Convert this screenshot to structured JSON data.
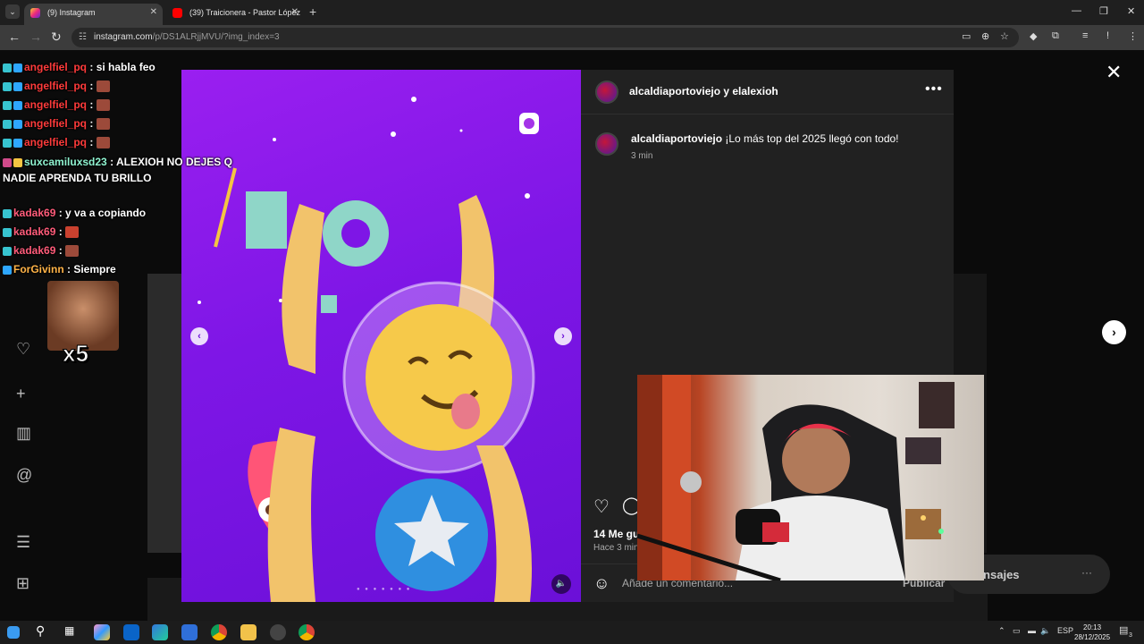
{
  "browser": {
    "tabs": [
      {
        "title": "(9) Instagram",
        "active": true
      },
      {
        "title": "(39) Traicionera - Pastor López",
        "active": false
      }
    ],
    "url_host": "instagram.com",
    "url_path": "/p/DS1ALRjjMVU/?img_index=3"
  },
  "post": {
    "author_header": "alcaldiaportoviejo y elalexioh",
    "caption_user": "alcaldiaportoviejo",
    "caption_text": "¡Lo más top del 2025 llegó con todo!",
    "caption_time": "3 min",
    "likes": "14 Me gusta",
    "time_ago": "Hace 3 minutos",
    "comment_placeholder": "Añade un comentario...",
    "publish_label": "Publicar"
  },
  "messages": {
    "label": "Mensajes",
    "badge": "9+"
  },
  "chat": [
    {
      "user": "angelfiel_pq",
      "text": ": si habla feo",
      "color": "red",
      "emote": false
    },
    {
      "user": "angelfiel_pq",
      "text": ":",
      "color": "red",
      "emote": true
    },
    {
      "user": "angelfiel_pq",
      "text": ":",
      "color": "red",
      "emote": true
    },
    {
      "user": "angelfiel_pq",
      "text": ":",
      "color": "red",
      "emote": true
    },
    {
      "user": "angelfiel_pq",
      "text": ":",
      "color": "red",
      "emote": true
    },
    {
      "user": "suxcamiluxsd23",
      "text": ": ALEXIOH NO DEJES Q",
      "color": "cyan",
      "emote": false
    },
    {
      "user": "",
      "text": "NADIE APRENDA TU BRILLO",
      "color": "white",
      "emote": false
    },
    {
      "user": "kadak69",
      "text": ": y va a copiando",
      "color": "pink",
      "emote": false
    },
    {
      "user": "kadak69",
      "text": ":",
      "color": "pink",
      "emote": true
    },
    {
      "user": "kadak69",
      "text": ":",
      "color": "pink",
      "emote": true
    },
    {
      "user": "ForGivinn",
      "text": ": Siempre",
      "color": "orange",
      "emote": false
    }
  ],
  "chat_emote_label": "x5",
  "taskbar": {
    "language": "ESP",
    "time": "20:13",
    "date": "28/12/2025",
    "notifications": "3"
  },
  "icons": {
    "tab_menu": "chevron-down-icon",
    "instagram_favicon": "instagram-icon",
    "youtube_favicon": "youtube-icon",
    "close": "close-icon",
    "heart": "heart-icon",
    "comment": "comment-icon",
    "emoji": "emoji-icon",
    "next": "chevron-right-icon"
  },
  "colors": {
    "instagram_bg": "#0b0b0b",
    "panel_bg": "#212121",
    "media_purple": "#8a1aec",
    "accent_red": "#ff3040"
  }
}
